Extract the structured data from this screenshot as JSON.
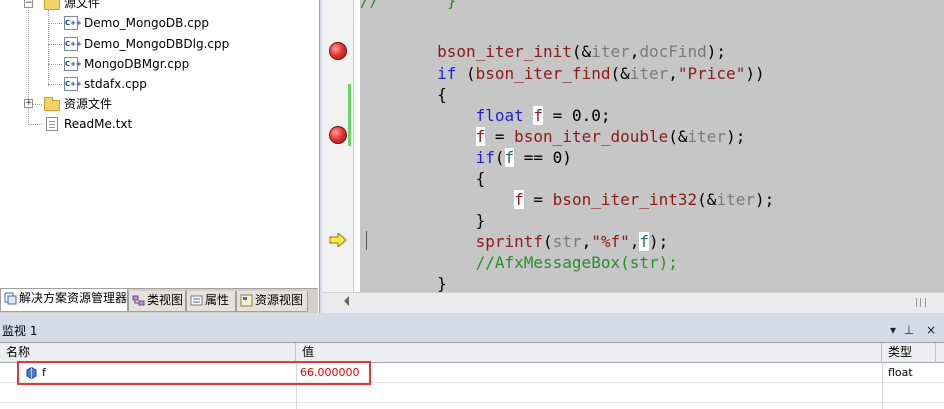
{
  "solution_explorer": {
    "tree": {
      "source_folder": "源文件",
      "source_files": [
        "Demo_MongoDB.cpp",
        "Demo_MongoDBDlg.cpp",
        "MongoDBMgr.cpp",
        "stdafx.cpp"
      ],
      "resource_folder": "资源文件",
      "readme": "ReadMe.txt"
    },
    "tabs": [
      "解决方案资源管理器",
      "类视图",
      "属性",
      "资源视图"
    ],
    "file_icon_text": "C++"
  },
  "editor": {
    "code_lines": [
      {
        "parts": [
          {
            "t": "//       }",
            "c": "cm"
          }
        ]
      },
      {
        "parts": [
          {
            "t": "        ",
            "c": ""
          },
          {
            "t": "bson_iter_init",
            "c": "fn"
          },
          {
            "t": "(&",
            "c": ""
          },
          {
            "t": "iter",
            "c": "var"
          },
          {
            "t": ",",
            "c": ""
          },
          {
            "t": "docFind",
            "c": "var"
          },
          {
            "t": ");",
            "c": ""
          }
        ]
      },
      {
        "parts": [
          {
            "t": "        ",
            "c": ""
          },
          {
            "t": "if",
            "c": "kw"
          },
          {
            "t": " (",
            "c": ""
          },
          {
            "t": "bson_iter_find",
            "c": "fn"
          },
          {
            "t": "(&",
            "c": ""
          },
          {
            "t": "iter",
            "c": "var"
          },
          {
            "t": ",",
            "c": ""
          },
          {
            "t": "\"Price\"",
            "c": "str"
          },
          {
            "t": "))",
            "c": ""
          }
        ]
      },
      {
        "parts": [
          {
            "t": "        {",
            "c": ""
          }
        ]
      },
      {
        "parts": [
          {
            "t": "            ",
            "c": ""
          },
          {
            "t": "float",
            "c": "kw"
          },
          {
            "t": " ",
            "c": ""
          },
          {
            "t": "f",
            "c": "hl"
          },
          {
            "t": " = 0.0;",
            "c": ""
          }
        ]
      },
      {
        "parts": [
          {
            "t": "            ",
            "c": ""
          },
          {
            "t": "f",
            "c": "hl"
          },
          {
            "t": " = ",
            "c": ""
          },
          {
            "t": "bson_iter_double",
            "c": "fn"
          },
          {
            "t": "(&",
            "c": ""
          },
          {
            "t": "iter",
            "c": "var"
          },
          {
            "t": ");",
            "c": ""
          }
        ]
      },
      {
        "parts": [
          {
            "t": "            ",
            "c": ""
          },
          {
            "t": "if",
            "c": "kw"
          },
          {
            "t": "(",
            "c": ""
          },
          {
            "t": "f",
            "c": "hl2"
          },
          {
            "t": " == 0)",
            "c": ""
          }
        ]
      },
      {
        "parts": [
          {
            "t": "            {",
            "c": ""
          }
        ]
      },
      {
        "parts": [
          {
            "t": "                ",
            "c": ""
          },
          {
            "t": "f",
            "c": "hl"
          },
          {
            "t": " = ",
            "c": ""
          },
          {
            "t": "bson_iter_int32",
            "c": "fn"
          },
          {
            "t": "(&",
            "c": ""
          },
          {
            "t": "iter",
            "c": "var"
          },
          {
            "t": ");",
            "c": ""
          }
        ]
      },
      {
        "parts": [
          {
            "t": "            }",
            "c": ""
          }
        ]
      },
      {
        "parts": [
          {
            "t": "            ",
            "c": ""
          },
          {
            "t": "sprintf",
            "c": "fn"
          },
          {
            "t": "(",
            "c": ""
          },
          {
            "t": "str",
            "c": "var"
          },
          {
            "t": ",",
            "c": ""
          },
          {
            "t": "\"%f\"",
            "c": "str"
          },
          {
            "t": ",",
            "c": ""
          },
          {
            "t": "f",
            "c": "hl2"
          },
          {
            "t": ");",
            "c": ""
          }
        ]
      },
      {
        "parts": [
          {
            "t": "            ",
            "c": ""
          },
          {
            "t": "//AfxMessageBox(str);",
            "c": "cm"
          }
        ]
      },
      {
        "parts": [
          {
            "t": "        }",
            "c": ""
          }
        ]
      }
    ]
  },
  "watch": {
    "title": "监视 1",
    "columns": {
      "name": "名称",
      "value": "值",
      "type": "类型"
    },
    "rows": [
      {
        "name": "f",
        "value": "66.000000",
        "type": "float"
      }
    ],
    "pin_glyph": "⊥",
    "close_glyph": "×",
    "dropdown_glyph": "▾",
    "colors": {
      "value_changed": "#e00000",
      "highlight_box": "#e23a3a"
    }
  }
}
